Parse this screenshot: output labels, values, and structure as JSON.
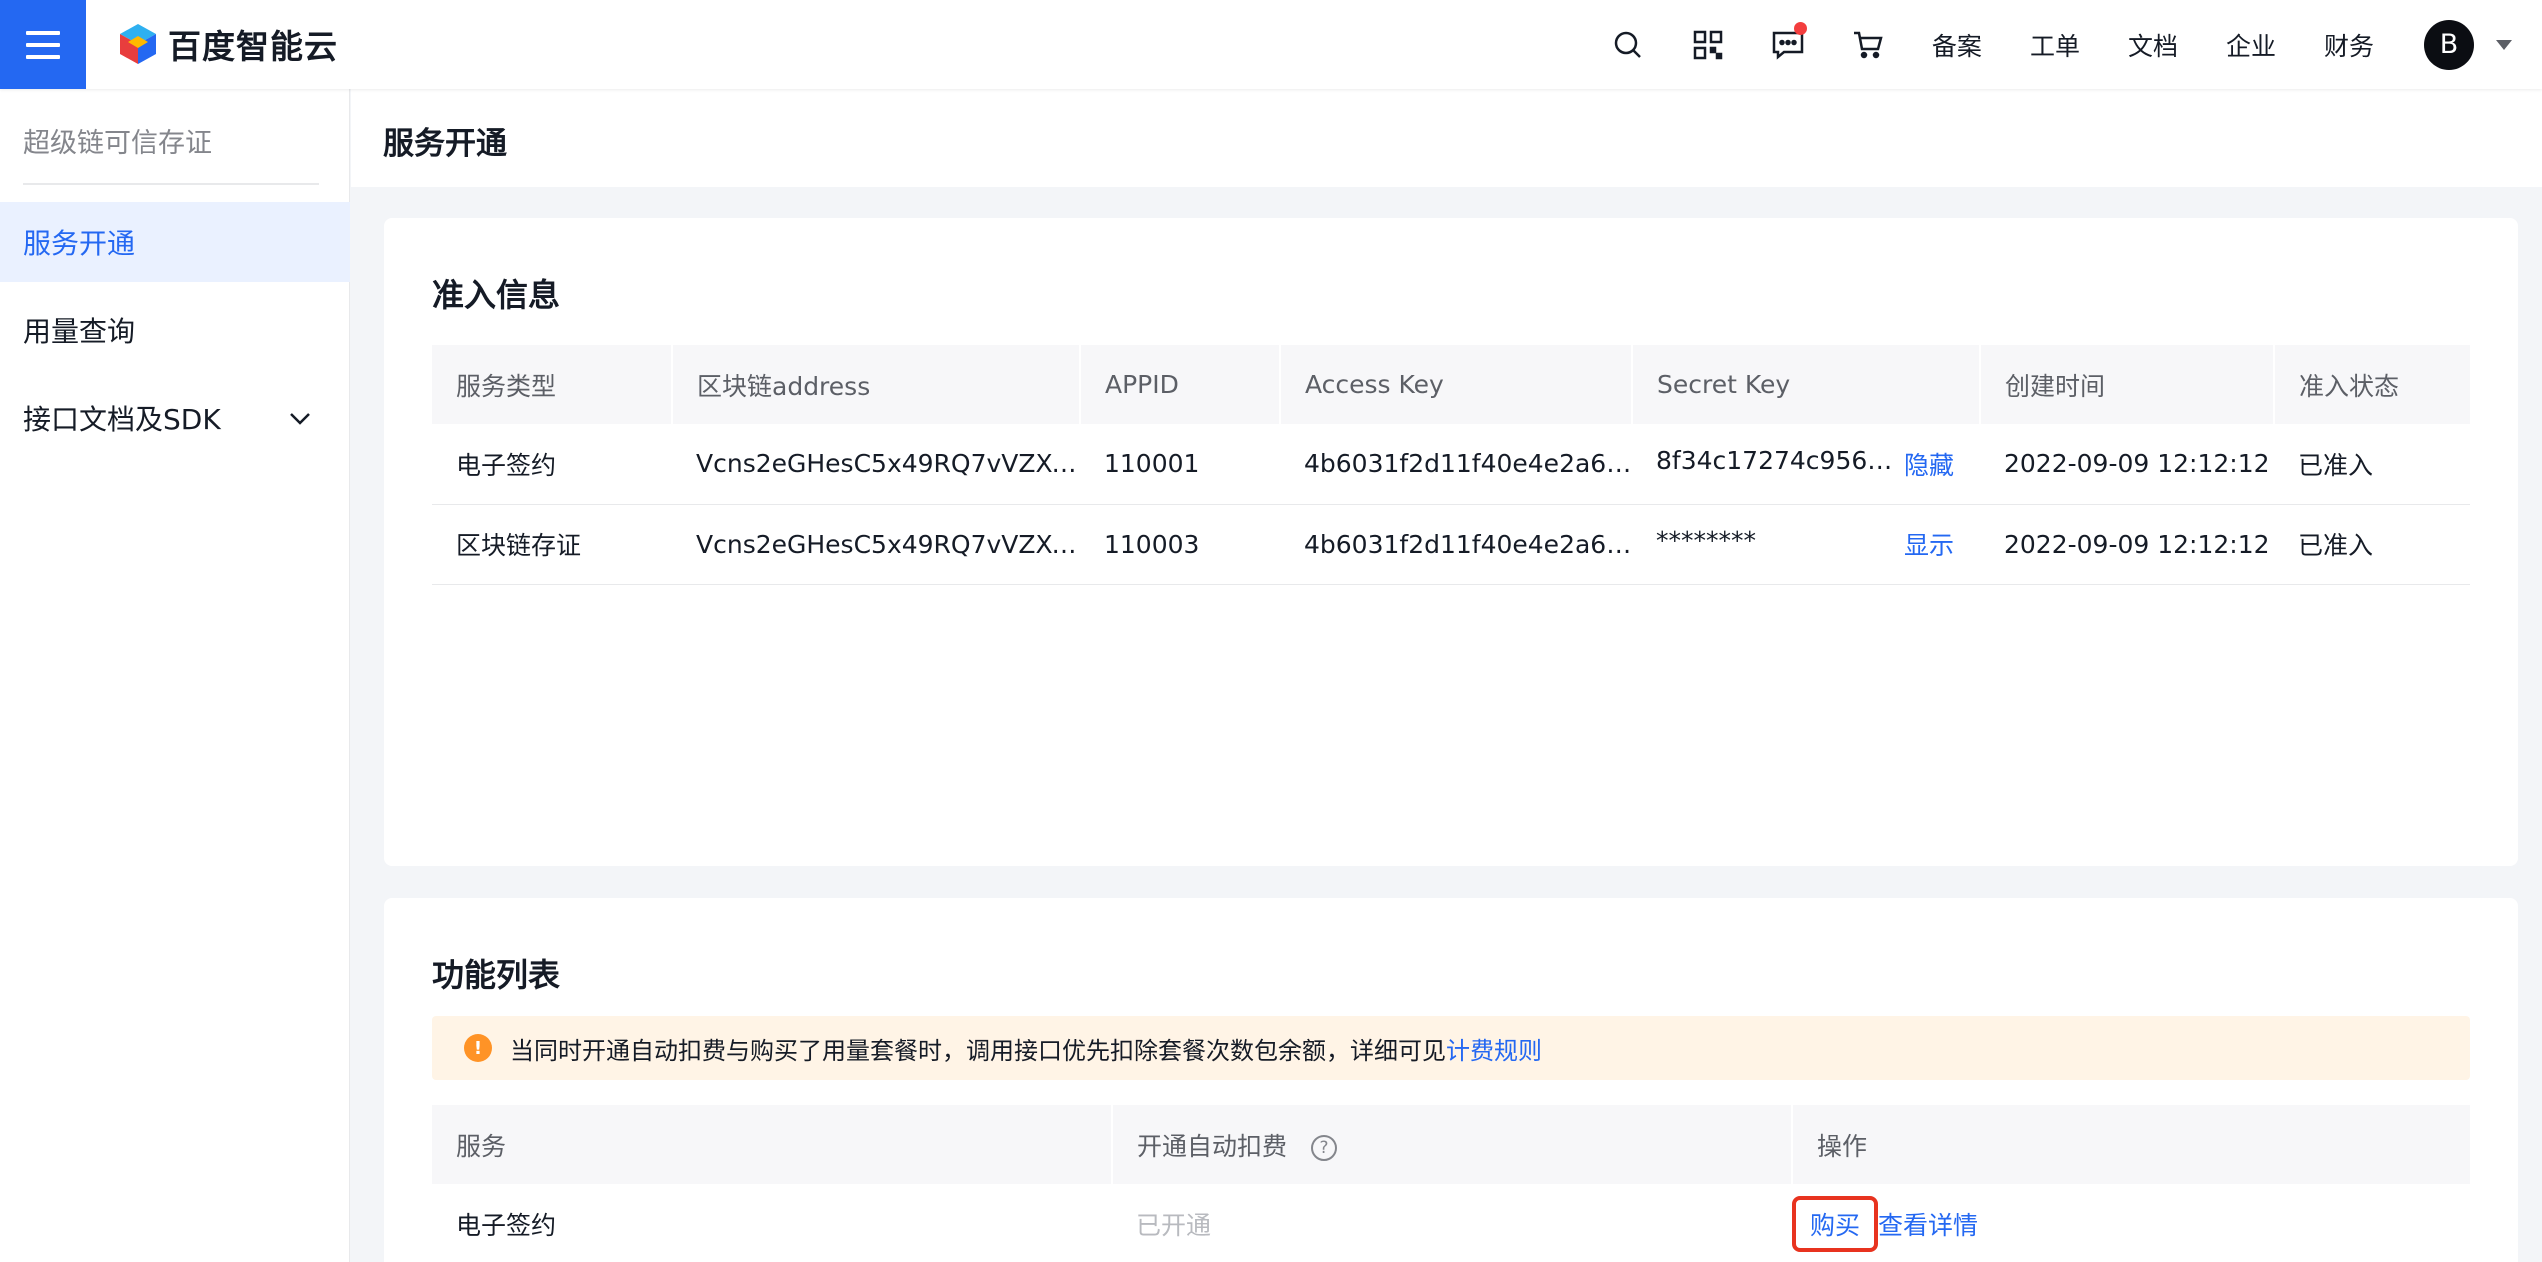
{
  "topbar": {
    "logo_text": "百度智能云",
    "nav_links": [
      "备案",
      "工单",
      "文档",
      "企业",
      "财务"
    ],
    "avatar_letter": "B"
  },
  "sidebar": {
    "title": "超级链可信存证",
    "items": [
      {
        "label": "服务开通",
        "active": true
      },
      {
        "label": "用量查询",
        "active": false
      },
      {
        "label": "接口文档及SDK",
        "active": false
      }
    ]
  },
  "page": {
    "title": "服务开通"
  },
  "access_info": {
    "title": "准入信息",
    "columns": [
      "服务类型",
      "区块链address",
      "APPID",
      "Access Key",
      "Secret Key",
      "创建时间",
      "准入状态"
    ],
    "rows": [
      {
        "service": "电子签约",
        "address": "Vcns2eGHesC5x49RQ7vVZXe...",
        "appid": "110001",
        "access_key": "4b6031f2d11f40e4e2a641...",
        "secret_key": "8f34c17274c95631...",
        "secret_action": "隐藏",
        "created": "2022-09-09 12:12:12",
        "status": "已准入"
      },
      {
        "service": "区块链存证",
        "address": "Vcns2eGHesC5x49RQ7vVZXe...",
        "appid": "110003",
        "access_key": "4b6031f2d11f40e4e2a641...",
        "secret_key": "********",
        "secret_action": "显示",
        "created": "2022-09-09 12:12:12",
        "status": "已准入"
      }
    ]
  },
  "feature_list": {
    "title": "功能列表",
    "notice_text": "当同时开通自动扣费与购买了用量套餐时，调用接口优先扣除套餐次数包余额，详细可见",
    "notice_link": "计费规则",
    "columns": [
      "服务",
      "开通自动扣费",
      "操作"
    ],
    "rows": [
      {
        "service": "电子签约",
        "auto_pay": "已开通",
        "buy": "购买",
        "detail": "查看详情"
      }
    ]
  },
  "colors": {
    "primary": "#2468f2",
    "warning": "#ff9326",
    "highlight": "#e8331f"
  }
}
